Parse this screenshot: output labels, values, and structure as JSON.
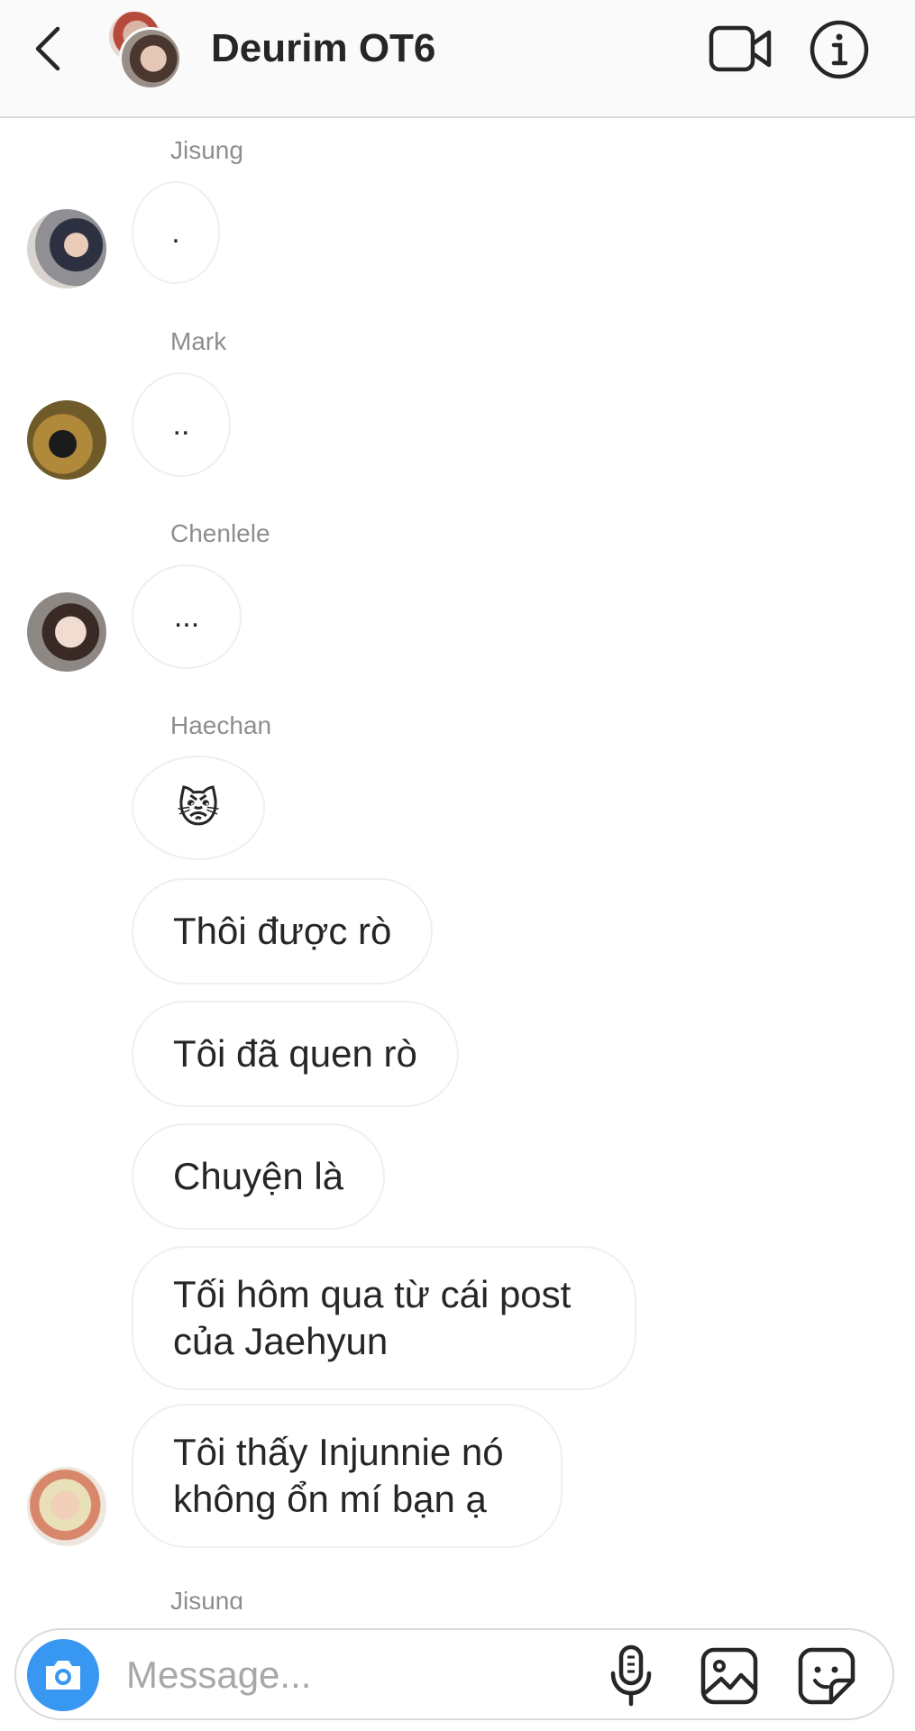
{
  "header": {
    "title": "Deurim OT6",
    "icons": {
      "back": "chevron-left-icon",
      "video": "video-camera-icon",
      "info": "info-icon"
    }
  },
  "thread": {
    "messages": [
      {
        "sender": "Jisung",
        "text": "."
      },
      {
        "sender": "Mark",
        "text": ".."
      },
      {
        "sender": "Chenlele",
        "text": "..."
      },
      {
        "sender": "Haechan",
        "texts": [
          "😾",
          "Thôi được rò",
          "Tôi đã quen rò",
          "Chuyện là",
          "Tối hôm qua từ cái post của Jaehyun",
          "Tôi thấy Injunnie nó không ổn mí bạn ạ"
        ]
      },
      {
        "sender": "Jisung"
      }
    ]
  },
  "composer": {
    "placeholder": "Message...",
    "icons": {
      "camera": "camera-icon",
      "mic": "microphone-icon",
      "gallery": "image-icon",
      "sticker": "sticker-icon"
    },
    "accent_color": "#3897f0"
  }
}
